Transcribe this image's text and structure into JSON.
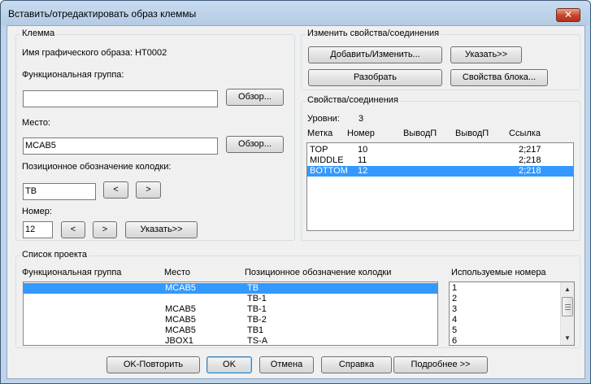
{
  "window": {
    "title": "Вставить/отредактировать образ клеммы",
    "close_glyph": "✕"
  },
  "klemma": {
    "group_title": "Клемма",
    "graphic_name_label": "Имя графического образа: HT0002",
    "func_group_label": "Функциональная группа:",
    "func_group_value": "",
    "browse_label": "Обзор...",
    "place_label": "Место:",
    "place_value": "MCAB5",
    "terminal_strip_label": "Позиционное обозначение колодки:",
    "terminal_strip_value": "TB",
    "prev_glyph": "<",
    "next_glyph": ">",
    "number_label": "Номер:",
    "number_value": "12",
    "specify_label": "Указать>>"
  },
  "change_props": {
    "group_title": "Изменить свойства/соединения",
    "add_edit_label": "Добавить/Изменить...",
    "specify_label": "Указать>>",
    "explode_label": "Разобрать",
    "block_props_label": "Свойства блока..."
  },
  "props_connections": {
    "group_title": "Свойства/соединения",
    "levels_label": "Уровни:",
    "levels_value": "3",
    "columns": [
      "Метка",
      "Номер",
      "ВыводП",
      "ВыводП",
      "Ссылка"
    ],
    "rows": [
      {
        "label": "TOP",
        "number": "10",
        "ref": "2;217",
        "selected": false
      },
      {
        "label": "MIDDLE",
        "number": "11",
        "ref": "2;218",
        "selected": false
      },
      {
        "label": "BOTTOM",
        "number": "12",
        "ref": "2;218",
        "selected": true
      }
    ]
  },
  "project_list": {
    "group_title": "Список проекта",
    "columns": [
      "Функциональная группа",
      "Место",
      "Позиционное обозначение колодки"
    ],
    "rows": [
      {
        "func": "",
        "place": "MCAB5",
        "strip": "TB",
        "selected": true
      },
      {
        "func": "",
        "place": "",
        "strip": "TB-1",
        "selected": false
      },
      {
        "func": "",
        "place": "MCAB5",
        "strip": "TB-1",
        "selected": false
      },
      {
        "func": "",
        "place": "MCAB5",
        "strip": "TB-2",
        "selected": false
      },
      {
        "func": "",
        "place": "MCAB5",
        "strip": "TB1",
        "selected": false
      },
      {
        "func": "",
        "place": "JBOX1",
        "strip": "TS-A",
        "selected": false
      }
    ],
    "used_numbers_label": "Используемые номера",
    "used_numbers": [
      "1",
      "2",
      "3",
      "4",
      "5",
      "6"
    ],
    "scroll_up_glyph": "▲",
    "scroll_down_glyph": "▼"
  },
  "footer": {
    "ok_repeat_label": "OK-Повторить",
    "ok_label": "OK",
    "cancel_label": "Отмена",
    "help_label": "Справка",
    "details_label": "Подробнее >>"
  }
}
